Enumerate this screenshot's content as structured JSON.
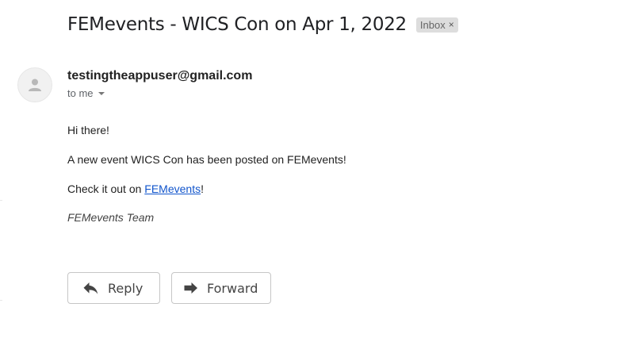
{
  "message": {
    "subject": "FEMevents - WICS Con on Apr 1, 2022",
    "label": "Inbox",
    "label_remove": "×",
    "sender": "testingtheappuser@gmail.com",
    "recipient_summary": "to me"
  },
  "body": {
    "greeting": "Hi there!",
    "announcement": "A new event WICS Con has been posted on FEMevents!",
    "cta_prefix": "Check it out on ",
    "cta_link": "FEMevents",
    "cta_suffix": "!",
    "signature": "FEMevents Team"
  },
  "actions": {
    "reply": "Reply",
    "forward": "Forward"
  },
  "colors": {
    "link": "#1155cc",
    "label_chip_bg": "#dddddd",
    "button_border": "#c6c6c6"
  },
  "icons": {
    "avatar": "person-icon",
    "reply": "reply-arrow-icon",
    "forward": "forward-arrow-icon",
    "recipient_details": "caret-down-icon",
    "label_remove": "close-icon"
  }
}
